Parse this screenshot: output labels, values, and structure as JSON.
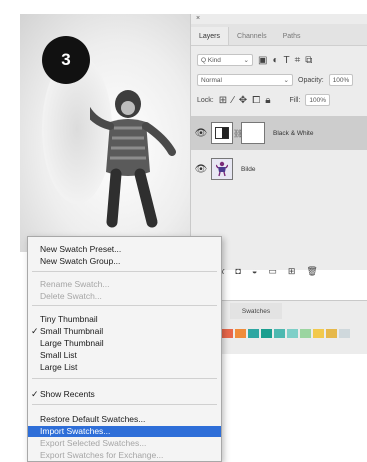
{
  "step_badge": "3",
  "layers_panel": {
    "close": "×",
    "tabs": [
      "Layers",
      "Channels",
      "Paths"
    ],
    "kind_filter": "Q Kind",
    "blend_mode": "Normal",
    "opacity_label": "Opacity:",
    "opacity_value": "100%",
    "lock_label": "Lock:",
    "fill_label": "Fill:",
    "fill_value": "100%",
    "layers": [
      {
        "name": "Black & White",
        "selected": true
      },
      {
        "name": "Bilde",
        "selected": false
      }
    ],
    "bottom_icons": [
      "link-icon",
      "fx-icon",
      "mask-icon",
      "adjustment-icon",
      "group-icon",
      "new-layer-icon",
      "trash-icon"
    ]
  },
  "swatches_panel": {
    "tab_label": "Swatches",
    "colors": [
      "#e8674a",
      "#f08c3a",
      "#2ea7a2",
      "#1a9e8f",
      "#4db8b0",
      "#7ecfc8",
      "#9bd5a0",
      "#f2c94c",
      "#e6b84a",
      "#cfd8dc"
    ]
  },
  "menu": {
    "items": [
      {
        "label": "New Swatch Preset...",
        "disabled": false,
        "checked": false,
        "highlighted": false
      },
      {
        "label": "New Swatch Group...",
        "disabled": false,
        "checked": false,
        "highlighted": false
      },
      {
        "label": "Rename Swatch...",
        "disabled": true,
        "checked": false,
        "highlighted": false
      },
      {
        "label": "Delete Swatch...",
        "disabled": true,
        "checked": false,
        "highlighted": false
      },
      {
        "label": "Tiny Thumbnail",
        "disabled": false,
        "checked": false,
        "highlighted": false
      },
      {
        "label": "Small Thumbnail",
        "disabled": false,
        "checked": true,
        "highlighted": false
      },
      {
        "label": "Large Thumbnail",
        "disabled": false,
        "checked": false,
        "highlighted": false
      },
      {
        "label": "Small List",
        "disabled": false,
        "checked": false,
        "highlighted": false
      },
      {
        "label": "Large List",
        "disabled": false,
        "checked": false,
        "highlighted": false
      },
      {
        "label": "Show Recents",
        "disabled": false,
        "checked": true,
        "highlighted": false
      },
      {
        "label": "Restore Default Swatches...",
        "disabled": false,
        "checked": false,
        "highlighted": false
      },
      {
        "label": "Import Swatches...",
        "disabled": false,
        "checked": false,
        "highlighted": true
      },
      {
        "label": "Export Selected Swatches...",
        "disabled": true,
        "checked": false,
        "highlighted": false
      },
      {
        "label": "Export Swatches for Exchange...",
        "disabled": true,
        "checked": false,
        "highlighted": false
      }
    ],
    "checkmark": "✓",
    "highlight_color": "#2e6ed8"
  }
}
